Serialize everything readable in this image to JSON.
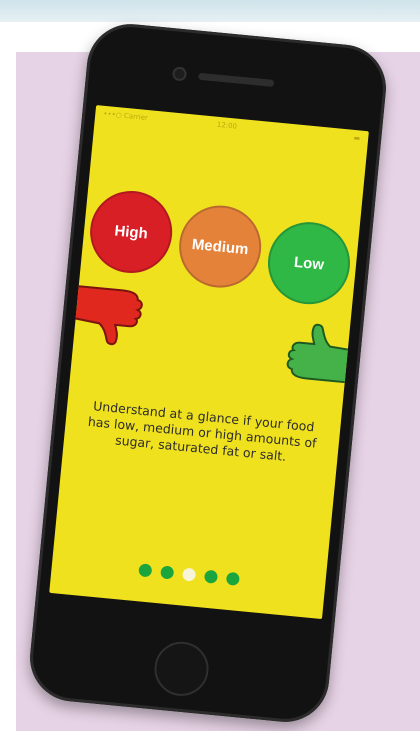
{
  "status_bar": {
    "carrier": "•••○ Carrier",
    "time": "12:00",
    "battery": "▬"
  },
  "circles": [
    {
      "label": "High",
      "color": "#d81f26"
    },
    {
      "label": "Medium",
      "color": "#e5823a"
    },
    {
      "label": "Low",
      "color": "#2fb845"
    }
  ],
  "icons": {
    "thumbs_down": "thumbs-down-icon",
    "thumbs_up": "thumbs-up-icon"
  },
  "description": "Understand at a glance if your food has low, medium or high amounts of sugar, saturated fat or salt.",
  "pagination": {
    "count": 5,
    "active_index": 2
  },
  "colors": {
    "screen_background": "#f0e11e",
    "thumb_down": "#e0281e",
    "thumb_up": "#44b248",
    "dot": "#1aa63c",
    "dot_active": "#f7f4d8",
    "backdrop": "#e7d3e6"
  }
}
